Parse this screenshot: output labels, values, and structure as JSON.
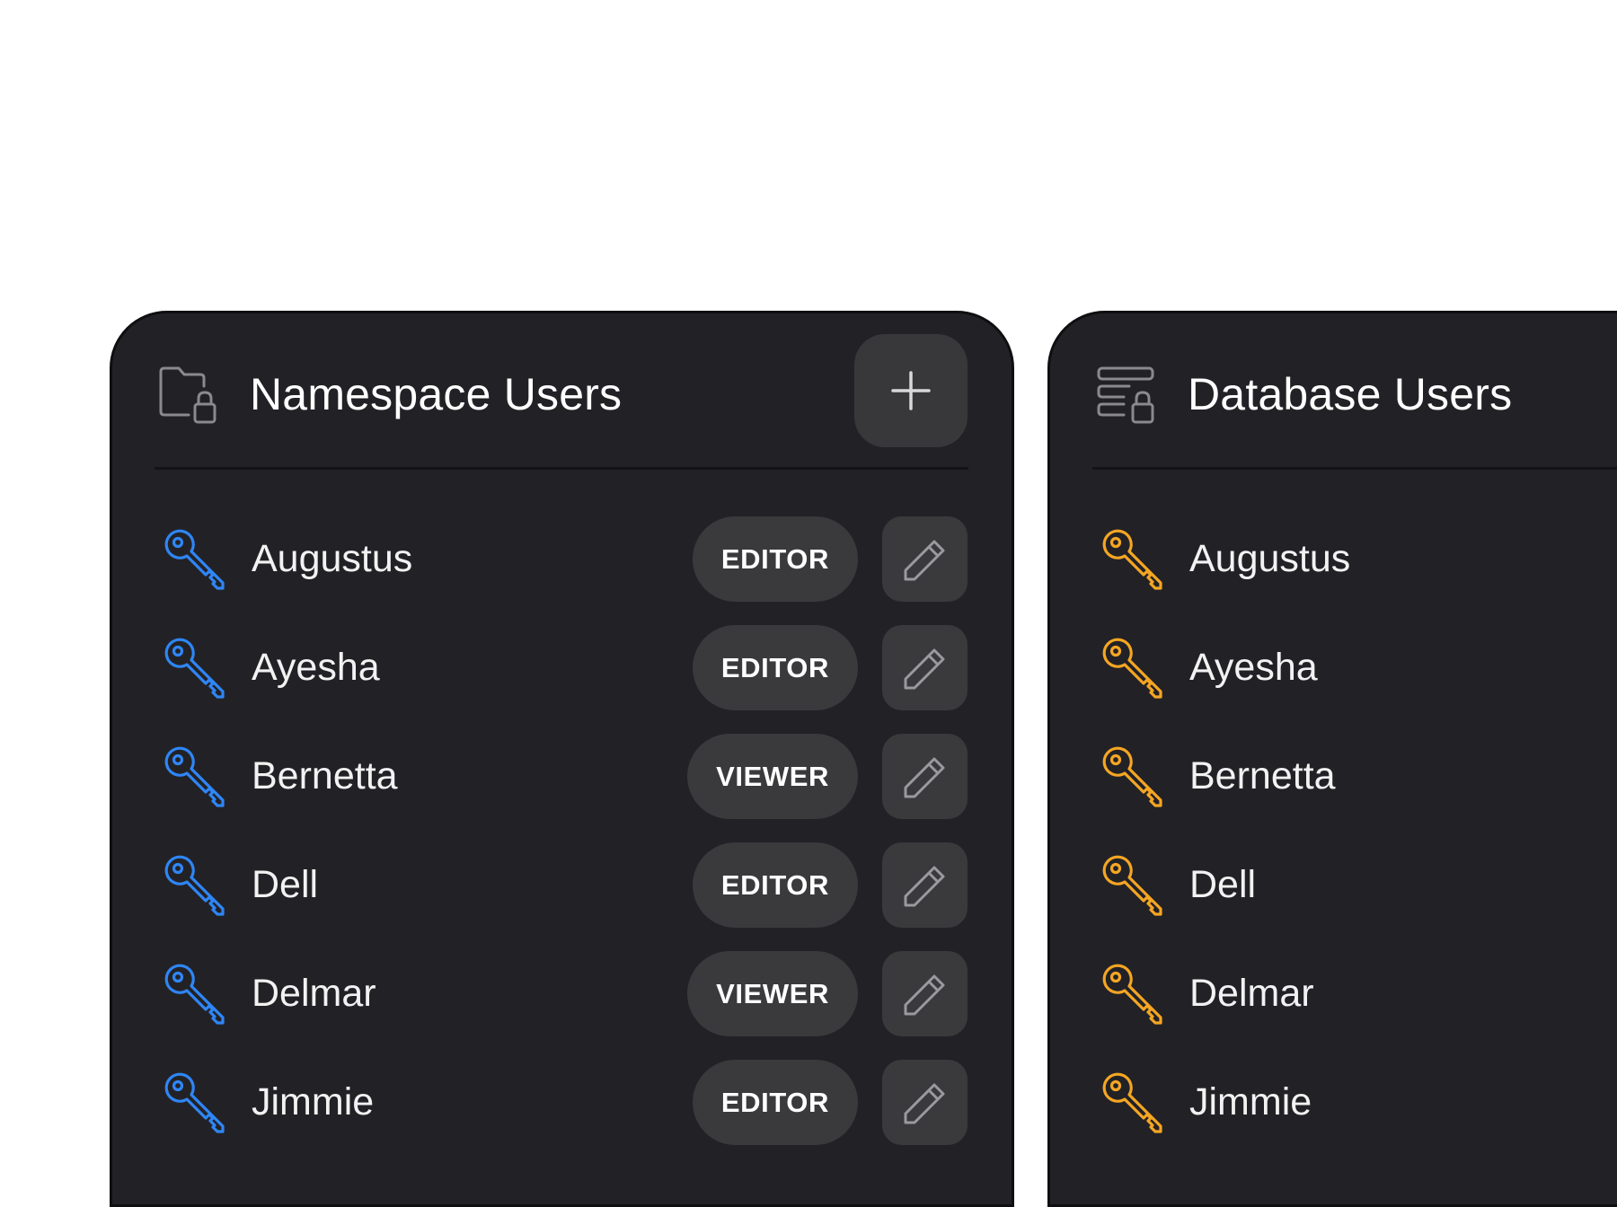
{
  "colors": {
    "namespace_key": "#2f86f6",
    "database_key": "#f5a623",
    "panel_bg": "#222226",
    "button_bg": "#3a3a3d"
  },
  "namespace_panel": {
    "icon": "folder-lock-icon",
    "title": "Namespace Users",
    "add_button_icon": "plus-icon",
    "users": [
      {
        "name": "Augustus",
        "role": "EDITOR",
        "icon": "key-icon",
        "action_icon": "pencil-icon"
      },
      {
        "name": "Ayesha",
        "role": "EDITOR",
        "icon": "key-icon",
        "action_icon": "pencil-icon"
      },
      {
        "name": "Bernetta",
        "role": "VIEWER",
        "icon": "key-icon",
        "action_icon": "pencil-icon"
      },
      {
        "name": "Dell",
        "role": "EDITOR",
        "icon": "key-icon",
        "action_icon": "pencil-icon"
      },
      {
        "name": "Delmar",
        "role": "VIEWER",
        "icon": "key-icon",
        "action_icon": "pencil-icon"
      },
      {
        "name": "Jimmie",
        "role": "EDITOR",
        "icon": "key-icon",
        "action_icon": "pencil-icon"
      }
    ]
  },
  "database_panel": {
    "icon": "database-lock-icon",
    "title": "Database Users",
    "users": [
      {
        "name": "Augustus",
        "icon": "key-icon"
      },
      {
        "name": "Ayesha",
        "icon": "key-icon"
      },
      {
        "name": "Bernetta",
        "icon": "key-icon"
      },
      {
        "name": "Dell",
        "icon": "key-icon"
      },
      {
        "name": "Delmar",
        "icon": "key-icon"
      },
      {
        "name": "Jimmie",
        "icon": "key-icon"
      }
    ]
  }
}
